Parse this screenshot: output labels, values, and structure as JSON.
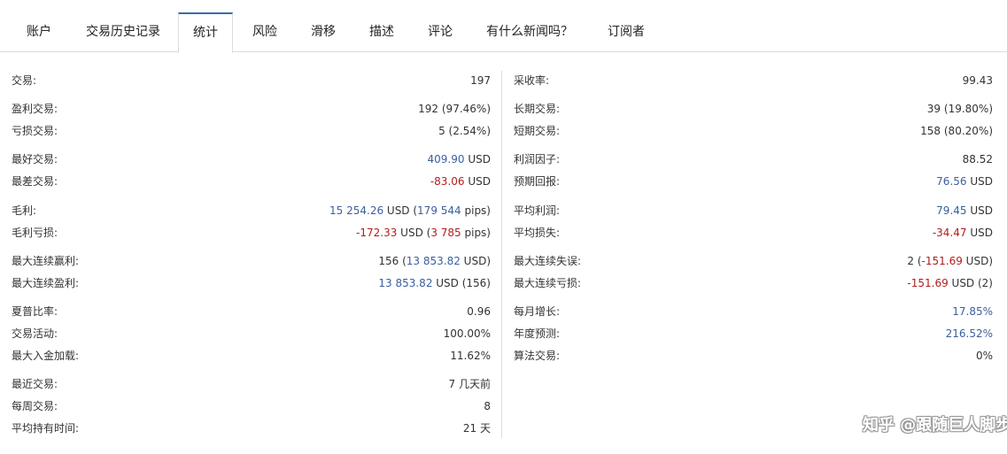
{
  "tabs": [
    {
      "label": "账户",
      "active": false
    },
    {
      "label": "交易历史记录",
      "active": false
    },
    {
      "label": "统计",
      "active": true
    },
    {
      "label": "风险",
      "active": false
    },
    {
      "label": "滑移",
      "active": false
    },
    {
      "label": "描述",
      "active": false
    },
    {
      "label": "评论",
      "active": false
    },
    {
      "label": "有什么新闻吗？",
      "active": false
    },
    {
      "label": "订阅者",
      "active": false
    }
  ],
  "left": {
    "trades": {
      "label": "交易:",
      "value": "197"
    },
    "profit_trades": {
      "label": "盈利交易:",
      "value": "192 (97.46%)"
    },
    "loss_trades": {
      "label": "亏损交易:",
      "value": "5 (2.54%)"
    },
    "best_trade": {
      "label": "最好交易:",
      "amount": "409.90",
      "unit": " USD"
    },
    "worst_trade": {
      "label": "最差交易:",
      "amount": "-83.06",
      "unit": " USD"
    },
    "gross_profit": {
      "label": "毛利:",
      "amount": "15 254.26",
      "unit": " USD (",
      "pips": "179 544",
      "pips_unit": " pips)"
    },
    "gross_loss": {
      "label": "毛利亏损:",
      "amount": "-172.33",
      "unit": " USD (",
      "pips": "3 785",
      "pips_unit": " pips)"
    },
    "max_consec_wins": {
      "label": "最大连续赢利:",
      "prefix": "156 (",
      "amount": "13 853.82",
      "suffix": " USD)"
    },
    "max_consec_profit": {
      "label": "最大连续盈利:",
      "amount": "13 853.82",
      "suffix": " USD (156)"
    },
    "sharpe": {
      "label": "夏普比率:",
      "value": "0.96"
    },
    "activity": {
      "label": "交易活动:",
      "value": "100.00%"
    },
    "max_deposit_load": {
      "label": "最大入金加载:",
      "value": "11.62%"
    },
    "latest_trade": {
      "label": "最近交易:",
      "value": "7 几天前"
    },
    "trades_per_week": {
      "label": "每周交易:",
      "value": "8"
    },
    "avg_holding": {
      "label": "平均持有时间:",
      "value": "21 天"
    }
  },
  "right": {
    "recovery_factor": {
      "label": "采收率:",
      "value": "99.43"
    },
    "long_trades": {
      "label": "长期交易:",
      "value": "39 (19.80%)"
    },
    "short_trades": {
      "label": "短期交易:",
      "value": "158 (80.20%)"
    },
    "profit_factor": {
      "label": "利润因子:",
      "value": "88.52"
    },
    "expected_payoff": {
      "label": "预期回报:",
      "amount": "76.56",
      "unit": " USD"
    },
    "avg_profit": {
      "label": "平均利润:",
      "amount": "79.45",
      "unit": " USD"
    },
    "avg_loss": {
      "label": "平均损失:",
      "amount": "-34.47",
      "unit": " USD"
    },
    "max_consec_losses": {
      "label": "最大连续失误:",
      "prefix": "2 (",
      "amount": "-151.69",
      "suffix": " USD)"
    },
    "max_consec_loss": {
      "label": "最大连续亏损:",
      "amount": "-151.69",
      "suffix": " USD (2)"
    },
    "monthly_growth": {
      "label": "每月增长:",
      "value": "17.85%"
    },
    "annual_forecast": {
      "label": "年度预测:",
      "value": "216.52%"
    },
    "algo_trading": {
      "label": "算法交易:",
      "value": "0%"
    }
  },
  "watermark": "知乎 @跟随巨人脚步",
  "colors": {
    "positive": "#3a5f9e",
    "negative": "#b11d1d",
    "active_tab_border": "#3a6ea8"
  }
}
